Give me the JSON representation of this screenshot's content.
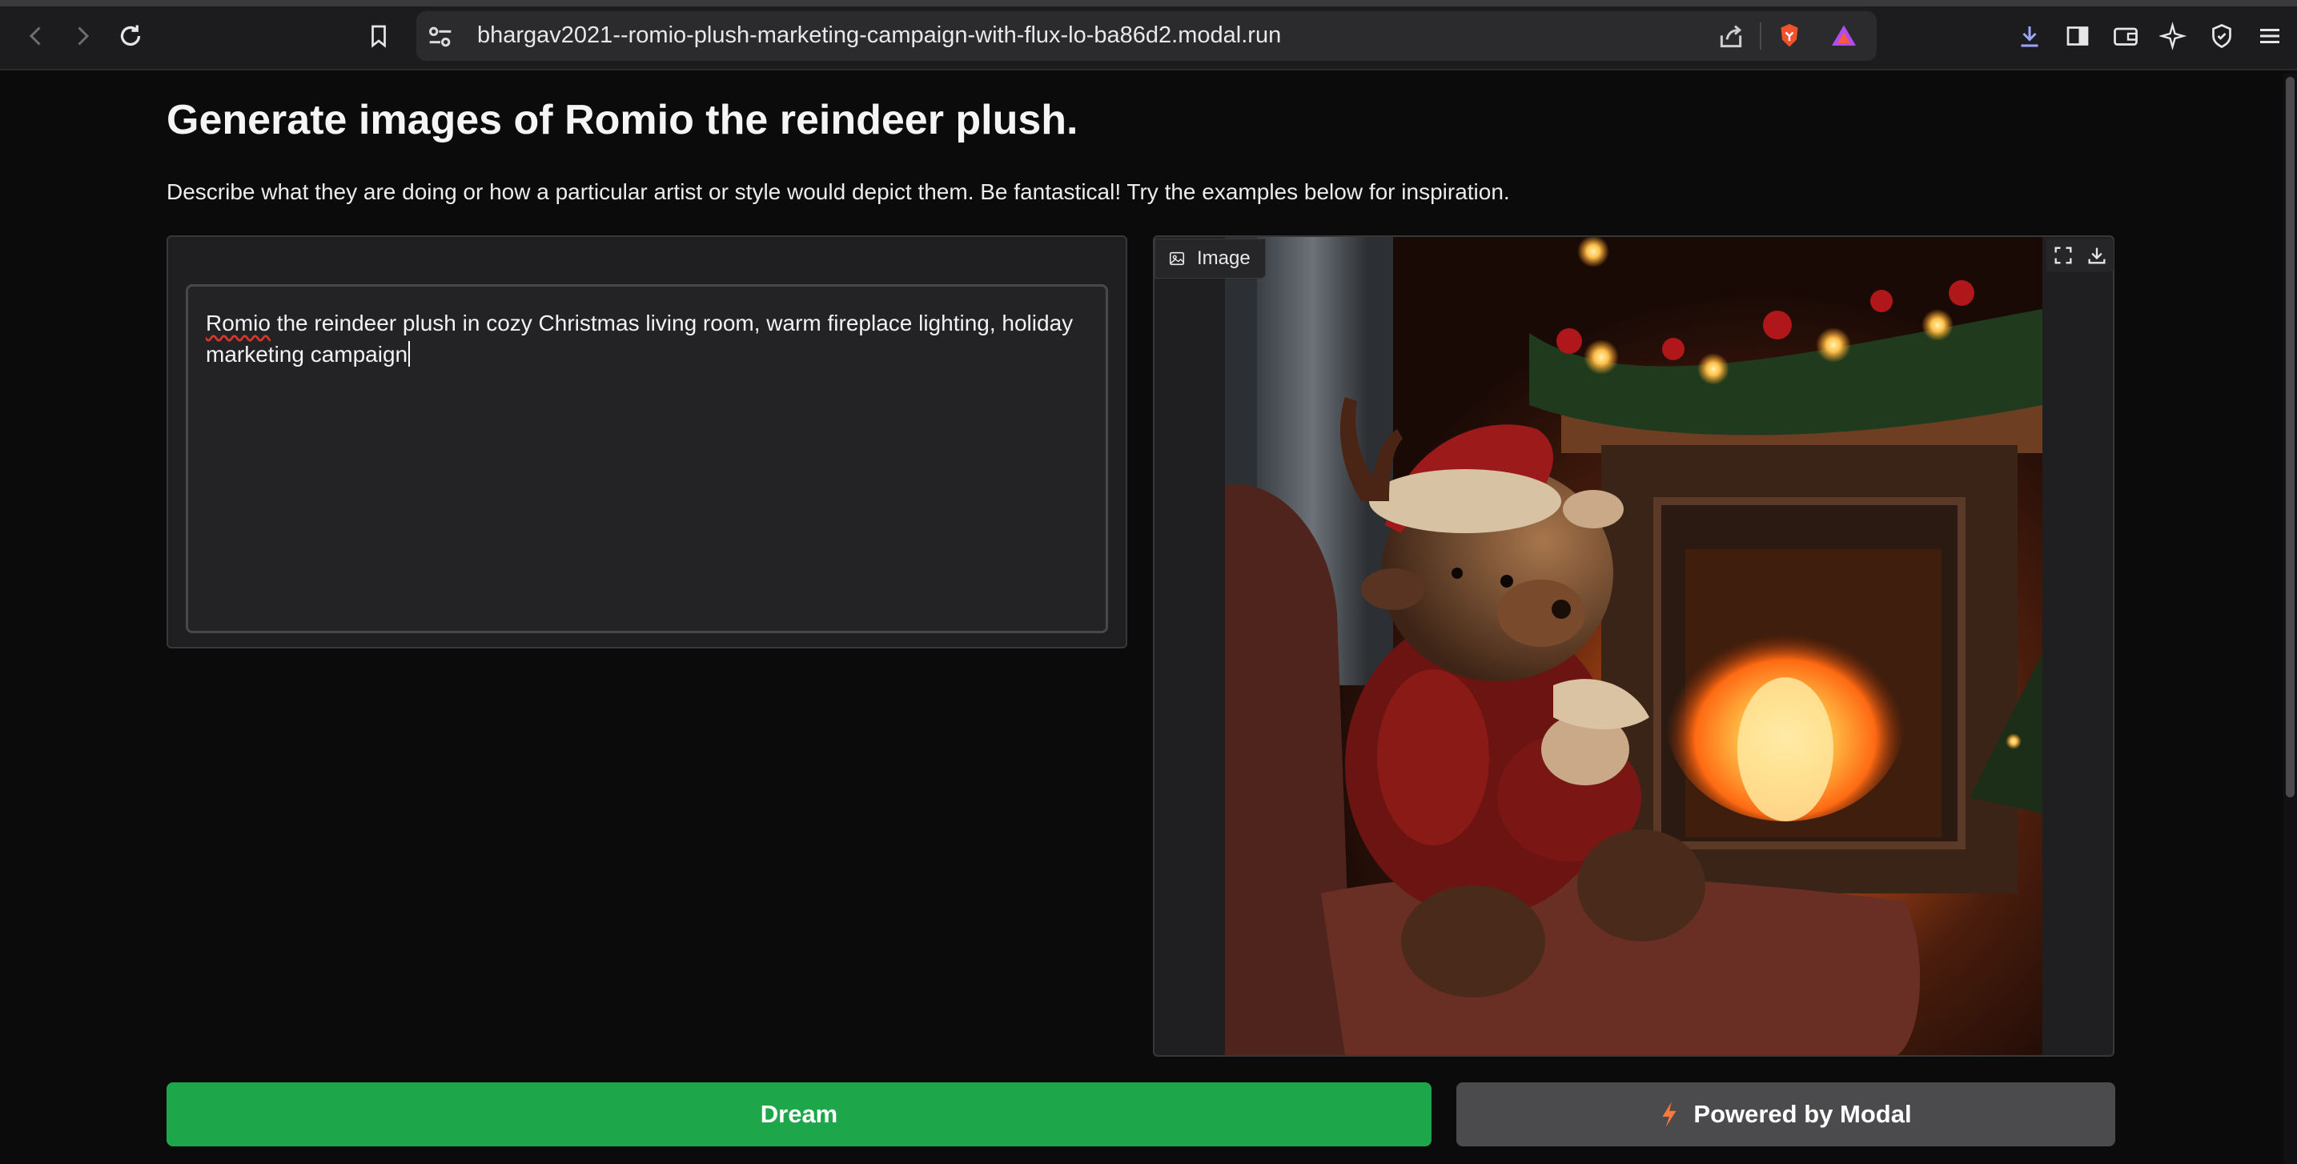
{
  "browser": {
    "url": "bhargav2021--romio-plush-marketing-campaign-with-flux-lo-ba86d2.modal.run",
    "icons": [
      "back-icon",
      "forward-icon",
      "reload-icon",
      "bookmark-icon",
      "site-settings-icon",
      "share-icon",
      "brave-shield-icon",
      "brave-rewards-icon",
      "downloads-icon",
      "sidebar-icon",
      "wallet-icon",
      "leo-ai-icon",
      "vpn-icon",
      "menu-icon"
    ]
  },
  "page": {
    "title": "Generate images of Romio the reindeer plush.",
    "description": "Describe what they are doing or how a particular artist or style would depict them. Be fantastical! Try the examples below for inspiration."
  },
  "prompt": {
    "first_word": "Romio",
    "rest": " the  reindeer plush in cozy Christmas living room, warm fireplace lighting, holiday marketing campaign"
  },
  "output": {
    "label": "Image",
    "image_subject": "reindeer plush by fireplace"
  },
  "buttons": {
    "dream": "Dream",
    "powered": "Powered by Modal"
  },
  "colors": {
    "dream_button": "#1ea64b",
    "modal_button": "#4b4b4e",
    "background": "#0b0b0c"
  }
}
